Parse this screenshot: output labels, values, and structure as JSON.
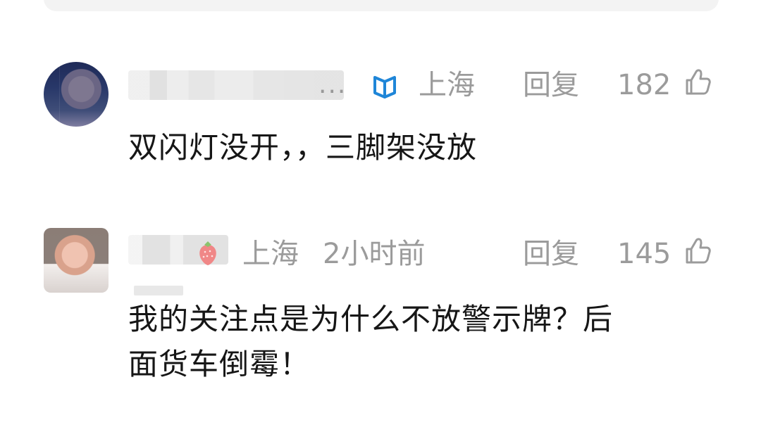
{
  "comments": [
    {
      "author_suffix": "...",
      "location": "上海",
      "reply_label": "回复",
      "like_count": "182",
      "text": "双闪灯没开，，三脚架没放"
    },
    {
      "location": "上海",
      "time": "2小时前",
      "reply_label": "回复",
      "like_count": "145",
      "text": "我的关注点是为什么不放警示牌？后\n面货车倒霉！"
    }
  ],
  "icons": {
    "badge": "verified-badge-icon",
    "fruit": "strawberry-icon",
    "like": "thumbs-up-icon"
  },
  "colors": {
    "badge": "#1f86d8",
    "meta_text": "#9b9b9b",
    "body_text": "#161616"
  }
}
